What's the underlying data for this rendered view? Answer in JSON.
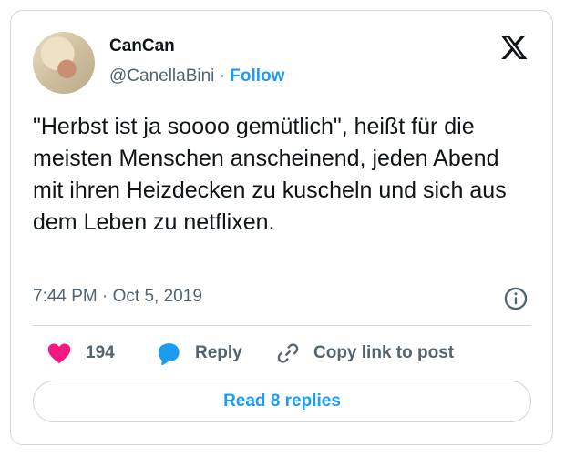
{
  "author": {
    "name": "CanCan",
    "handle": "@CanellaBini",
    "separator": "·",
    "follow_label": "Follow"
  },
  "tweet": {
    "text": "\"Herbst ist ja soooo gemütlich\", heißt für die meisten Menschen anscheinend, jeden Abend mit ihren Heizdecken zu kuscheln und sich aus dem Leben zu netflixen.",
    "time": "7:44 PM",
    "separator": "·",
    "date": "Oct 5, 2019"
  },
  "actions": {
    "like_count": "194",
    "reply_label": "Reply",
    "copy_label": "Copy link to post"
  },
  "footer": {
    "read_replies_label": "Read 8 replies"
  },
  "icons": {
    "logo": "x-logo-icon",
    "info": "info-icon",
    "like": "heart-icon",
    "reply": "speech-bubble-icon",
    "copy": "link-icon"
  },
  "colors": {
    "accent": "#1d9bf0",
    "heart": "#f91880",
    "text": "#0f1419",
    "muted": "#536471",
    "border": "#cfd9de"
  }
}
